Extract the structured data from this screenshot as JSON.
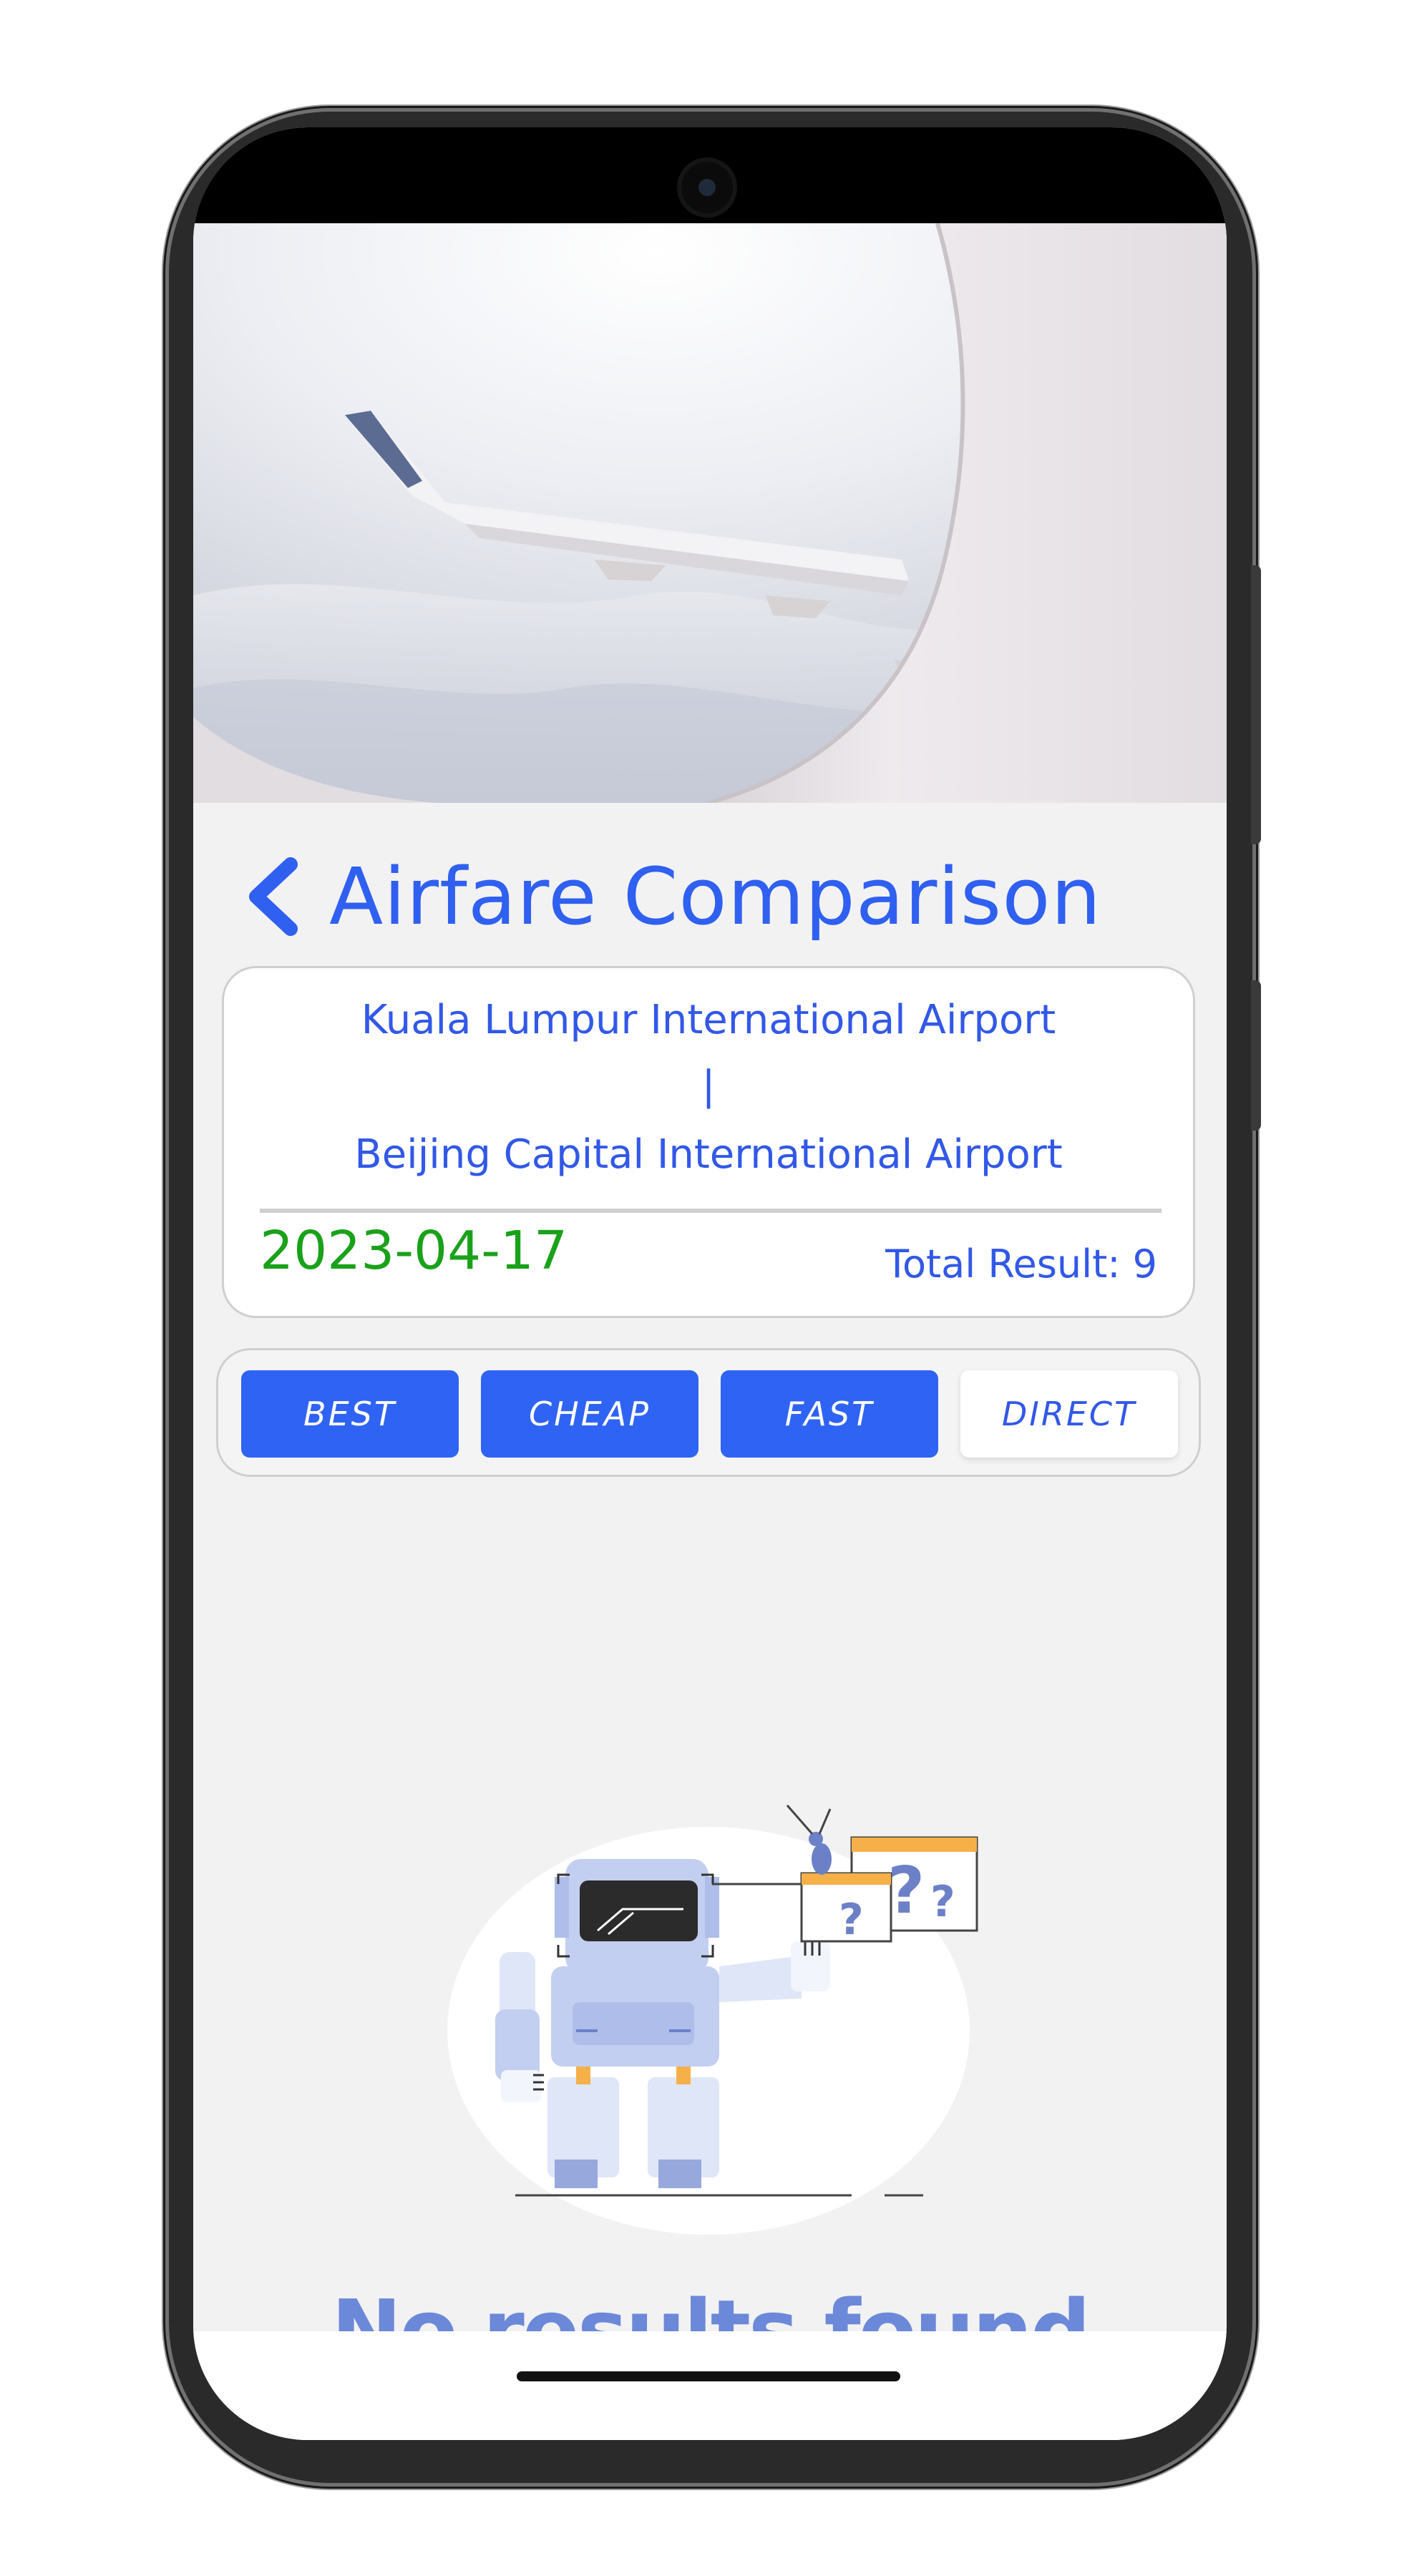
{
  "header": {
    "title": "Airfare Comparison",
    "back_icon": "chevron-left-icon"
  },
  "route": {
    "origin": "Kuala Lumpur International Airport",
    "separator": "|",
    "destination": "Beijing Capital International Airport",
    "date": "2023-04-17",
    "total_results": "Total Result: 9"
  },
  "filters": {
    "items": [
      {
        "label": "BEST",
        "active": true
      },
      {
        "label": "CHEAP",
        "active": true
      },
      {
        "label": "FAST",
        "active": true
      },
      {
        "label": "DIRECT",
        "active": false
      }
    ]
  },
  "empty_state": {
    "message": "No results found",
    "illustration": "robot-confused-illustration"
  },
  "colors": {
    "accent": "#2f63f3",
    "title": "#3060f0",
    "date": "#1aa11a",
    "empty_text": "#6c88d8"
  }
}
